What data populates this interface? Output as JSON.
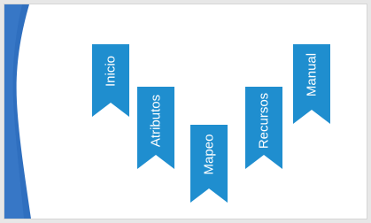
{
  "nav": {
    "accent_color": "#1f8ecf",
    "items": [
      {
        "id": "inicio",
        "label": "Inicio"
      },
      {
        "id": "atributos",
        "label": "Atributos"
      },
      {
        "id": "mapeo",
        "label": "Mapeo"
      },
      {
        "id": "recursos",
        "label": "Recursos"
      },
      {
        "id": "manual",
        "label": "Manual"
      }
    ]
  }
}
